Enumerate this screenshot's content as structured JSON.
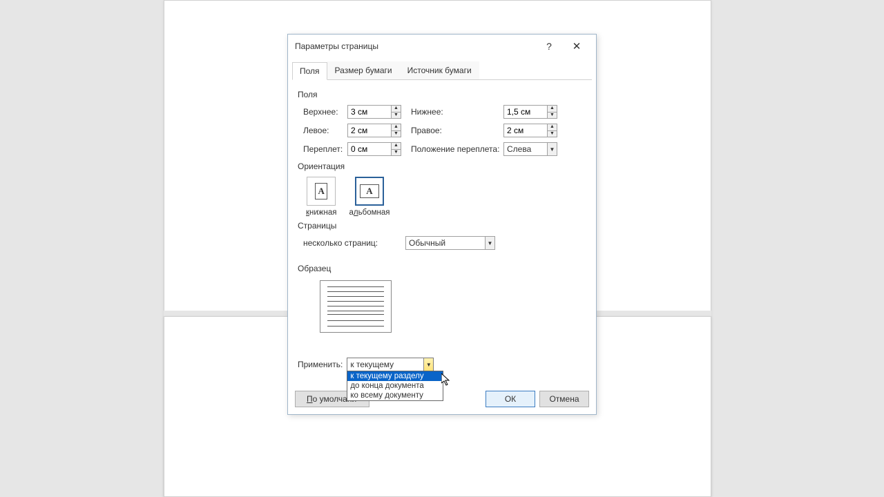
{
  "dialog": {
    "title": "Параметры страницы",
    "help_glyph": "?",
    "close_glyph": "✕",
    "tabs": {
      "t0": "Поля",
      "t1": "Размер бумаги",
      "t2": "Источник бумаги"
    },
    "section_margins": "Поля",
    "top_label": "Верхнее:",
    "top_value": "3 см",
    "bottom_label": "Нижнее:",
    "bottom_value": "1,5 см",
    "left_label": "Левое:",
    "left_value": "2 см",
    "right_label": "Правое:",
    "right_value": "2 см",
    "gutter_label": "Переплет:",
    "gutter_value": "0 см",
    "gutter_pos_label": "Положение переплета:",
    "gutter_pos_value": "Слева",
    "section_orient": "Ориентация",
    "orient_portrait": "книжная",
    "orient_landscape": "альбомная",
    "section_pages": "Страницы",
    "multi_label": "несколько страниц:",
    "multi_value": "Обычный",
    "section_preview": "Образец",
    "apply_label": "Применить:",
    "apply_value": "к текущему разделу",
    "apply_opts": {
      "o0": "к текущему разделу",
      "o1": "до конца документа",
      "o2": "ко всему документу"
    },
    "btn_default": "По умолчанию...",
    "btn_ok": "ОК",
    "btn_cancel": "Отмена"
  }
}
